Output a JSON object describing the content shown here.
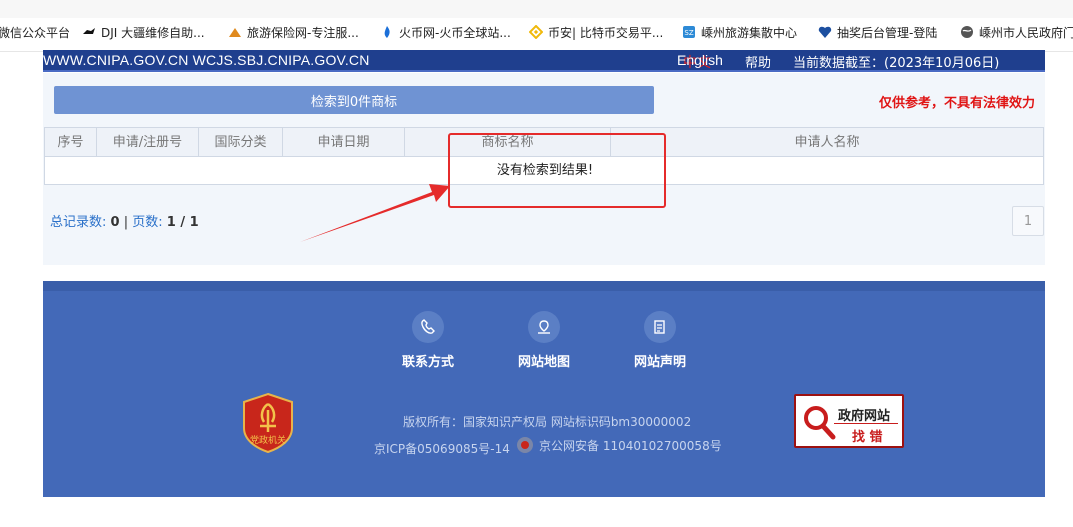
{
  "bookmarks": [
    {
      "label": "微信公众平台",
      "icon": "wechat-icon",
      "color": "#3c9b3c"
    },
    {
      "label": "DJI 大疆维修自助...",
      "icon": "dji-icon",
      "color": "#111111"
    },
    {
      "label": "旅游保险网-专注服...",
      "icon": "travel-insurance-icon",
      "color": "#e08a1e"
    },
    {
      "label": "火币网-火币全球站...",
      "icon": "huobi-icon",
      "color": "#1b6fd8"
    },
    {
      "label": "币安| 比特币交易平...",
      "icon": "binance-icon",
      "color": "#f0b90b"
    },
    {
      "label": "嵊州旅游集散中心",
      "icon": "tourism-center-icon",
      "color": "#2d8ad6"
    },
    {
      "label": "抽奖后台管理-登陆",
      "icon": "heart-shield-icon",
      "color": "#1c4fa0"
    },
    {
      "label": "嵊州市人民政府门",
      "icon": "globe-icon",
      "color": "#555555"
    }
  ],
  "header": {
    "domains": "WWW.CNIPA.GOV.CN WCJS.SBJ.CNIPA.GOV.CN",
    "lang_zh": "中文",
    "lang_en": "English",
    "help": "帮助",
    "data_date": "当前数据截至：(2023年10月06日)"
  },
  "search": {
    "result_label": "检索到0件商标",
    "disclaimer": "仅供参考，不具有法律效力"
  },
  "table": {
    "columns": [
      "序号",
      "申请/注册号",
      "国际分类",
      "申请日期",
      "商标名称",
      "申请人名称"
    ],
    "empty_message": "没有检索到结果!"
  },
  "pagination": {
    "total_label": "总记录数:",
    "total_value": "0",
    "separator": "|",
    "pages_label": "页数:",
    "pages_value": "1 / 1",
    "current_page": "1"
  },
  "footer": {
    "links": [
      {
        "label": "联系方式",
        "icon": "phone-icon"
      },
      {
        "label": "网站地图",
        "icon": "map-icon"
      },
      {
        "label": "网站声明",
        "icon": "document-icon"
      }
    ],
    "copyright": "版权所有：国家知识产权局 网站标识码bm30000002",
    "icp": "京ICP备05069085号-14",
    "police": "京公网安备 11040102700058号",
    "party_badge_text": "党政机关",
    "gov_button": {
      "line1": "政府网站",
      "line2": "找 错"
    }
  },
  "colors": {
    "header_bg": "#1f3f8e",
    "result_bar": "#6f93d3",
    "disclaimer": "#e01515",
    "footer_bg": "#4369b8",
    "annotation": "#e52b2b"
  }
}
